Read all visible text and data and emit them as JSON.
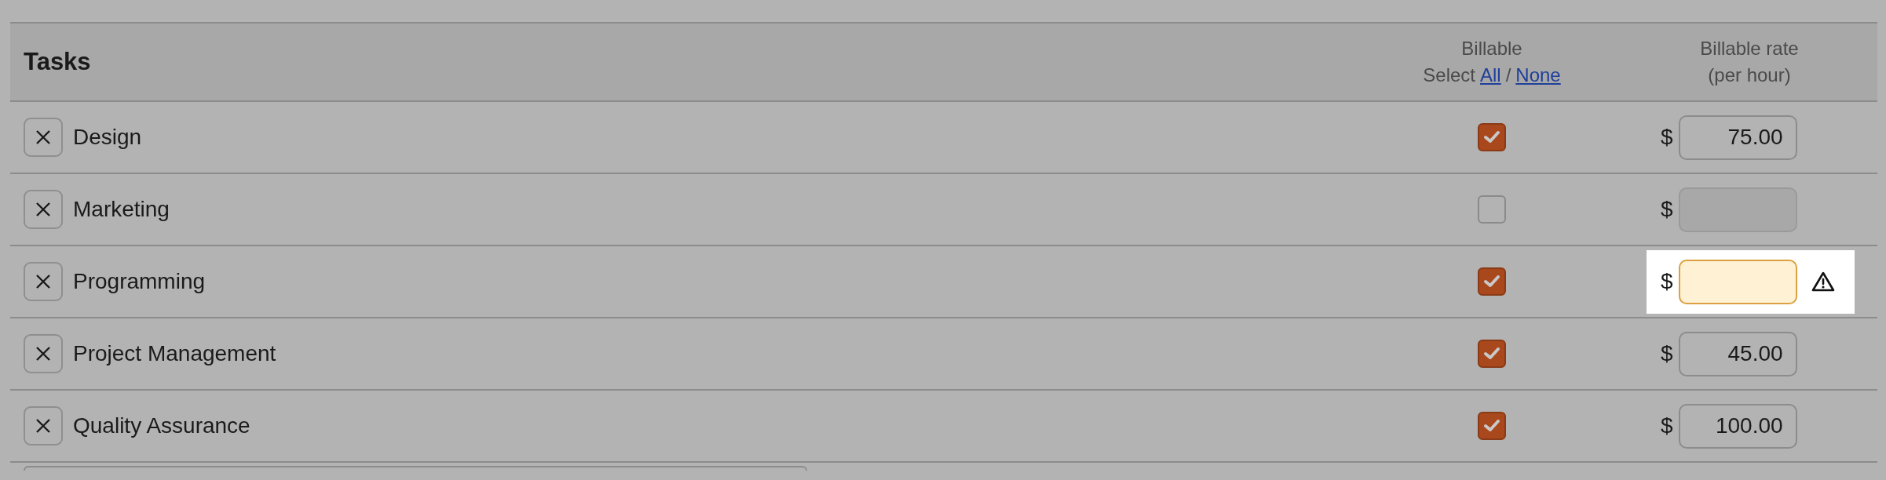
{
  "table": {
    "title": "Tasks",
    "columns": [
      {
        "kind": "billable",
        "label": "Billable",
        "select_prefix": "Select",
        "select_all": "All",
        "separator": "/",
        "select_none": "None"
      },
      {
        "kind": "rate",
        "label": "Billable rate",
        "sublabel": "(per hour)"
      }
    ],
    "rows": [
      {
        "name": "Design",
        "billable": true,
        "currency": "$",
        "rate": "75.00",
        "disabled": false,
        "warning": false
      },
      {
        "name": "Marketing",
        "billable": false,
        "currency": "$",
        "disabled": true,
        "warning": false
      },
      {
        "name": "Programming",
        "billable": true,
        "currency": "$",
        "disabled": false,
        "warning": true
      },
      {
        "name": "Project Management",
        "billable": true,
        "currency": "$",
        "rate": "45.00",
        "disabled": false,
        "warning": false
      },
      {
        "name": "Quality Assurance",
        "billable": true,
        "currency": "$",
        "rate": "100.00",
        "disabled": false,
        "warning": false
      }
    ]
  }
}
